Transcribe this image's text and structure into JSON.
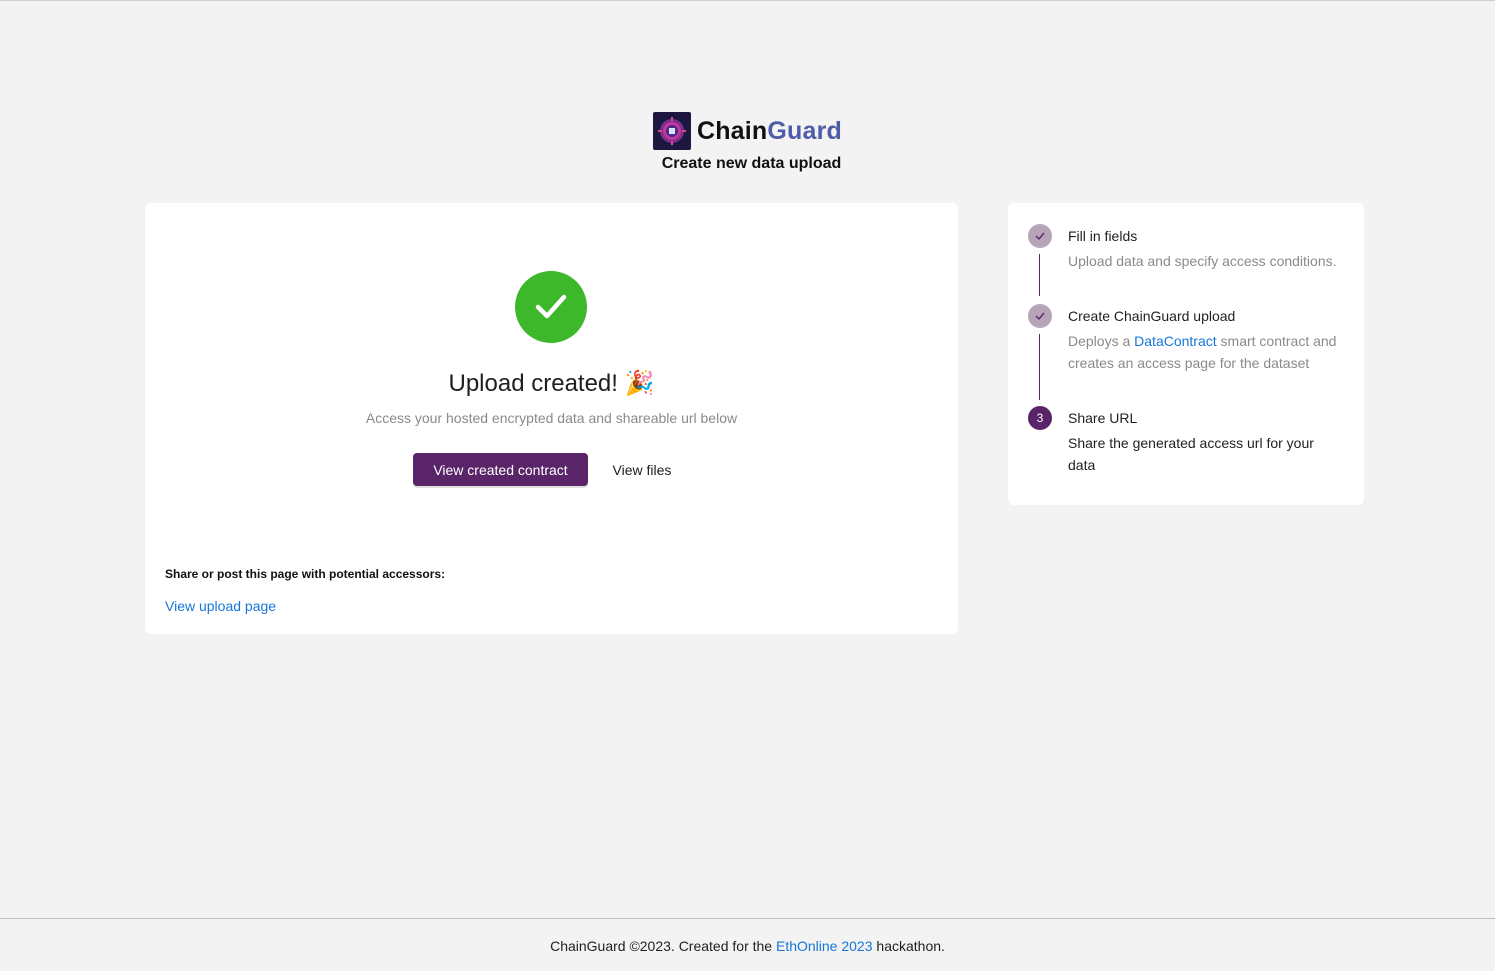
{
  "header": {
    "brand_part1": "Chain",
    "brand_part2": "Guard",
    "subtitle": "Create new data upload"
  },
  "result": {
    "title": "Upload created! 🎉",
    "subtitle": "Access your hosted encrypted data and shareable url below",
    "primary_button": "View created contract",
    "secondary_button": "View files",
    "share_label": "Share or post this page with potential accessors:",
    "share_link": "View upload page"
  },
  "steps": [
    {
      "title": "Fill in fields",
      "description": "Upload data and specify access conditions.",
      "status": "done"
    },
    {
      "title": "Create ChainGuard upload",
      "description_before": "Deploys a ",
      "description_link": "DataContract",
      "description_after": " smart contract and creates an access page for the dataset",
      "status": "done"
    },
    {
      "title": "Share URL",
      "number": "3",
      "description": "Share the generated access url for your data",
      "status": "active"
    }
  ],
  "footer": {
    "text_before": "ChainGuard ©2023. Created for the ",
    "link": "EthOnline 2023",
    "text_after": " hackathon."
  },
  "colors": {
    "accent": "#5a2468",
    "success": "#3cb82a",
    "link": "#1677d8",
    "brand_secondary": "#4f5ba6",
    "step_done": "#b7a5b7"
  }
}
